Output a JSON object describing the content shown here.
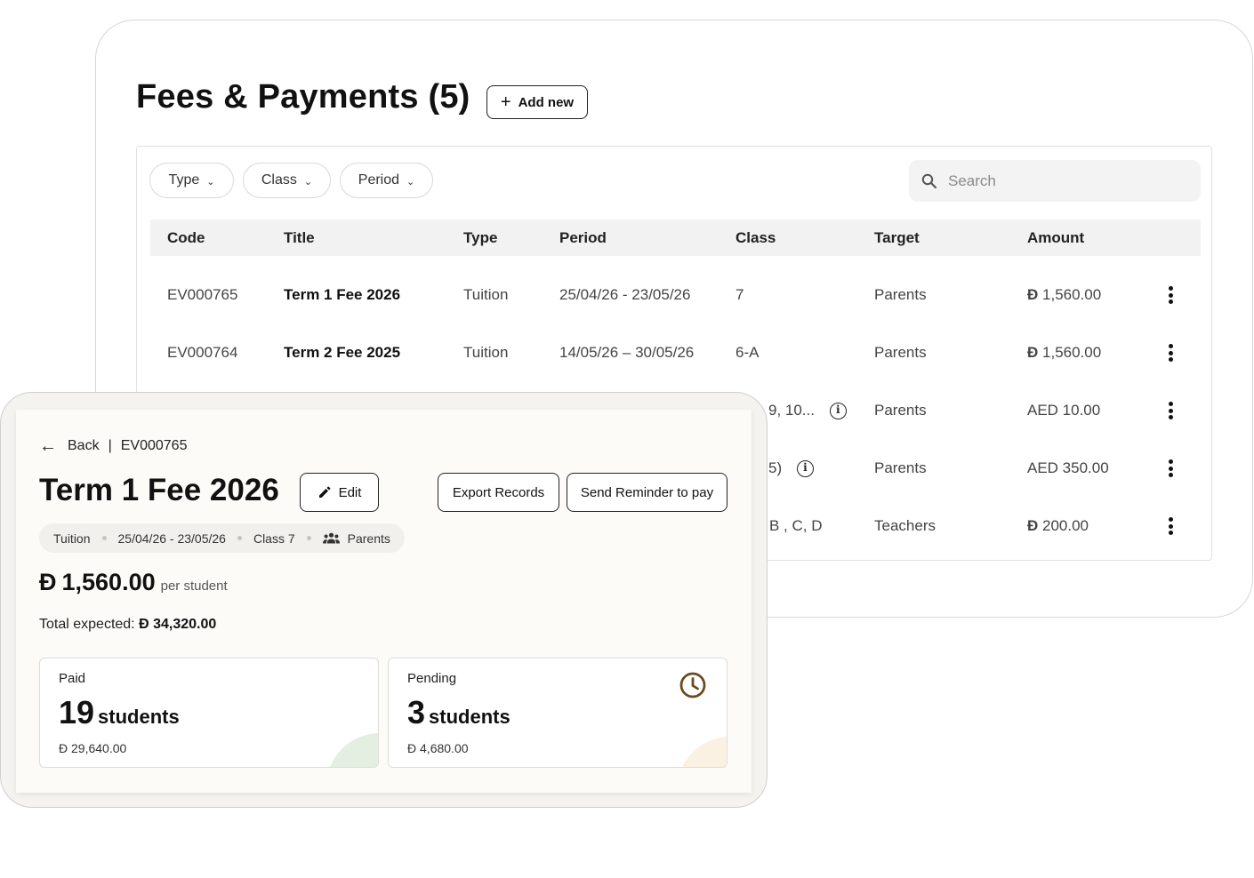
{
  "colors": {
    "accent_dark": "#111111",
    "panel_bg": "#fcfbf8",
    "paid_blob": "#e4eee1",
    "pending_blob": "#fbf1e2",
    "clock": "#6b4a1e"
  },
  "list": {
    "title": "Fees & Payments (5)",
    "add_new_label": "Add new",
    "filters": [
      {
        "label": "Type"
      },
      {
        "label": "Class"
      },
      {
        "label": "Period"
      }
    ],
    "search": {
      "placeholder": "Search",
      "value": ""
    },
    "columns": [
      "Code",
      "Title",
      "Type",
      "Period",
      "Class",
      "Target",
      "Amount"
    ],
    "rows": [
      {
        "code": "EV000765",
        "title": "Term 1 Fee 2026",
        "type": "Tuition",
        "period": "25/04/26 - 23/05/26",
        "class": "7",
        "target": "Parents",
        "amount": "1,560.00",
        "currency_icon": "dirham-icon"
      },
      {
        "code": "EV000764",
        "title": "Term 2 Fee 2025",
        "type": "Tuition",
        "period": "14/05/26 – 30/05/26",
        "class": "6-A",
        "target": "Parents",
        "amount": "1,560.00",
        "currency_icon": "dirham-icon"
      },
      {
        "code": "",
        "title": "",
        "type": "",
        "period": "",
        "class": "9, 10...",
        "target": "Parents",
        "amount": "AED 10.00",
        "currency_icon": ""
      },
      {
        "code": "",
        "title": "",
        "type": "",
        "period": "",
        "class": "5)",
        "target": "Parents",
        "amount": "AED 350.00",
        "currency_icon": ""
      },
      {
        "code": "",
        "title": "",
        "type": "",
        "period": "",
        "class": "B , C, D",
        "target": "Teachers",
        "amount": "200.00",
        "currency_icon": "dirham-icon"
      }
    ]
  },
  "detail": {
    "back_label": "Back",
    "separator": "|",
    "code": "EV000765",
    "title": "Term 1 Fee 2026",
    "edit_label": "Edit",
    "export_label": "Export Records",
    "reminder_label": "Send Reminder to pay",
    "meta": {
      "type": "Tuition",
      "period": "25/04/26 - 23/05/26",
      "class": "Class 7",
      "target": "Parents"
    },
    "price": "1,560.00",
    "price_suffix": "per student",
    "total_label": "Total expected:",
    "total_value": "34,320.00",
    "paid": {
      "label": "Paid",
      "count": "19",
      "unit": "students",
      "amount": "29,640.00"
    },
    "pending": {
      "label": "Pending",
      "count": "3",
      "unit": "students",
      "amount": "4,680.00"
    }
  }
}
